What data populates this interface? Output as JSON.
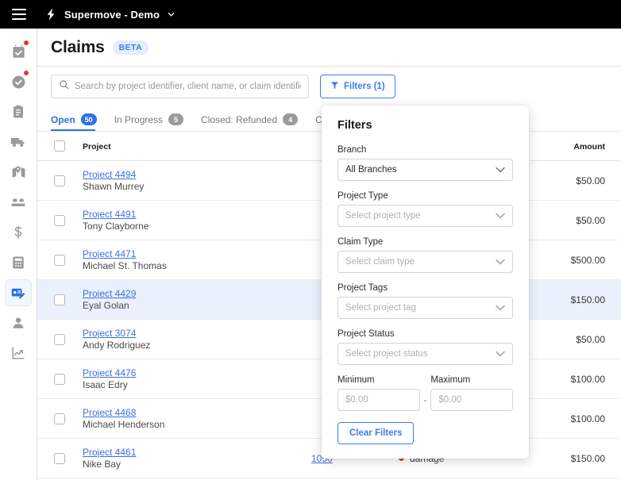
{
  "topbar": {
    "menu_icon": "hamburger-icon",
    "logo_icon": "lightning-bolt-icon",
    "brand": "Supermove - Demo",
    "caret": "∨"
  },
  "sidebar": {
    "items": [
      {
        "name": "calendar-check",
        "badge": true
      },
      {
        "name": "check-circle",
        "badge": true
      },
      {
        "name": "clipboard",
        "badge": false
      },
      {
        "name": "truck",
        "badge": false
      },
      {
        "name": "map-pin",
        "badge": false
      },
      {
        "name": "handshake",
        "badge": false
      },
      {
        "name": "dollar",
        "badge": false
      },
      {
        "name": "calculator",
        "badge": false
      },
      {
        "name": "claims-invoice",
        "badge": false,
        "active": true
      },
      {
        "name": "user",
        "badge": false
      },
      {
        "name": "analytics-chart",
        "badge": false
      }
    ]
  },
  "header": {
    "title": "Claims",
    "badge": "BETA"
  },
  "search": {
    "placeholder": "Search by project identifier, client name, or claim identifier",
    "value": "",
    "icon": "search-icon"
  },
  "filters_button": {
    "label": "Filters (1)",
    "icon": "funnel-icon"
  },
  "tabs": [
    {
      "label": "Open",
      "count": "50",
      "active": true
    },
    {
      "label": "In Progress",
      "count": "5",
      "active": false
    },
    {
      "label": "Closed: Refunded",
      "count": "4",
      "active": false
    },
    {
      "label": "Clo",
      "count": "",
      "active": false
    }
  ],
  "table": {
    "columns": {
      "project": "Project",
      "amount": "Amount"
    },
    "rows": [
      {
        "project": "Project 4494",
        "client": "Shawn Murrey",
        "claim": "",
        "type": "",
        "amount": "$50.00",
        "highlight": false
      },
      {
        "project": "Project 4491",
        "client": "Tony Clayborne",
        "claim": "",
        "type": "",
        "amount": "$50.00",
        "highlight": false
      },
      {
        "project": "Project 4471",
        "client": "Michael St. Thomas",
        "claim": "",
        "type": "",
        "amount": "$500.00",
        "highlight": false
      },
      {
        "project": "Project 4429",
        "client": "Eyal Golan",
        "claim": "",
        "type": "",
        "amount": "$150.00",
        "highlight": true
      },
      {
        "project": "Project 3074",
        "client": "Andy Rodriguez",
        "claim": "",
        "type": "",
        "amount": "$50.00",
        "highlight": false
      },
      {
        "project": "Project 4476",
        "client": "Isaac Edry",
        "claim": "",
        "type": "",
        "amount": "$100.00",
        "highlight": false
      },
      {
        "project": "Project 4468",
        "client": "Michael Henderson",
        "claim": "",
        "type": "",
        "amount": "$100.00",
        "highlight": false
      },
      {
        "project": "Project 4461",
        "client": "Nike Bay",
        "claim": "1050",
        "type": "damage",
        "amount": "$150.00",
        "highlight": false
      }
    ]
  },
  "filter_panel": {
    "title": "Filters",
    "branch": {
      "label": "Branch",
      "value": "All Branches",
      "is_placeholder": false
    },
    "project_type": {
      "label": "Project Type",
      "value": "Select project type",
      "is_placeholder": true
    },
    "claim_type": {
      "label": "Claim Type",
      "value": "Select claim type",
      "is_placeholder": true
    },
    "project_tags": {
      "label": "Project Tags",
      "value": "Select project tag",
      "is_placeholder": true
    },
    "project_status": {
      "label": "Project Status",
      "value": "Select project status",
      "is_placeholder": true
    },
    "minimum": {
      "label": "Minimum",
      "placeholder": "$0.00",
      "value": ""
    },
    "maximum": {
      "label": "Maximum",
      "placeholder": "$0.00",
      "value": ""
    },
    "separator": "-",
    "clear_label": "Clear Filters"
  },
  "colors": {
    "accent": "#3b7cf5",
    "link": "#3b6fe0",
    "badge_red": "#e8332a",
    "topbar_bg": "#000000",
    "row_highlight": "#eaf1fc",
    "status_dot": "#e8433c"
  }
}
